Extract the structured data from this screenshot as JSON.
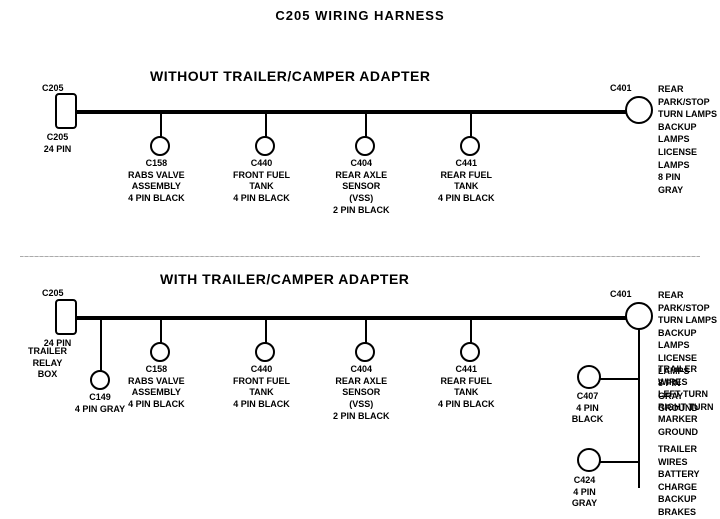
{
  "title": "C205 WIRING HARNESS",
  "section1": {
    "title": "WITHOUT TRAILER/CAMPER ADAPTER",
    "connectors": [
      {
        "id": "C205_top",
        "label": "C205\n24 PIN",
        "type": "rect"
      },
      {
        "id": "C158_top",
        "label": "C158\nRABS VALVE\nASSEMBLY\n4 PIN BLACK"
      },
      {
        "id": "C440_top",
        "label": "C440\nFRONT FUEL\nTANK\n4 PIN BLACK"
      },
      {
        "id": "C404_top",
        "label": "C404\nREAR AXLE\nSENSOR\n(VSS)\n2 PIN BLACK"
      },
      {
        "id": "C441_top",
        "label": "C441\nREAR FUEL\nTANK\n4 PIN BLACK"
      },
      {
        "id": "C401_top",
        "label": "C401",
        "label2": "REAR PARK/STOP\nTURN LAMPS\nBACKUP LAMPS\nLICENSE LAMPS\n8 PIN\nGRAY",
        "type": "circle-right"
      }
    ]
  },
  "section2": {
    "title": "WITH TRAILER/CAMPER ADAPTER",
    "connectors": [
      {
        "id": "C205_bot",
        "label": "C205\n24 PIN",
        "type": "rect"
      },
      {
        "id": "C149",
        "label": "TRAILER\nRELAY\nBOX\nC149\n4 PIN GRAY"
      },
      {
        "id": "C158_bot",
        "label": "C158\nRABS VALVE\nASSEMBLY\n4 PIN BLACK"
      },
      {
        "id": "C440_bot",
        "label": "C440\nFRONT FUEL\nTANK\n4 PIN BLACK"
      },
      {
        "id": "C404_bot",
        "label": "C404\nREAR AXLE\nSENSOR\n(VSS)\n2 PIN BLACK"
      },
      {
        "id": "C441_bot",
        "label": "C441\nREAR FUEL\nTANK\n4 PIN BLACK"
      },
      {
        "id": "C401_bot",
        "label": "C401",
        "label2": "REAR PARK/STOP\nTURN LAMPS\nBACKUP LAMPS\nLICENSE LAMPS\n8 PIN\nGRAY\nGROUND"
      },
      {
        "id": "C407",
        "label": "C407\n4 PIN\nBLACK",
        "label2": "TRAILER WIRES\nLEFT TURN\nRIGHT TURN\nMARKER\nGROUND"
      },
      {
        "id": "C424",
        "label": "C424\n4 PIN\nGRAY",
        "label2": "TRAILER WIRES\nBATTERY CHARGE\nBACKUP\nBRAKES"
      }
    ]
  }
}
